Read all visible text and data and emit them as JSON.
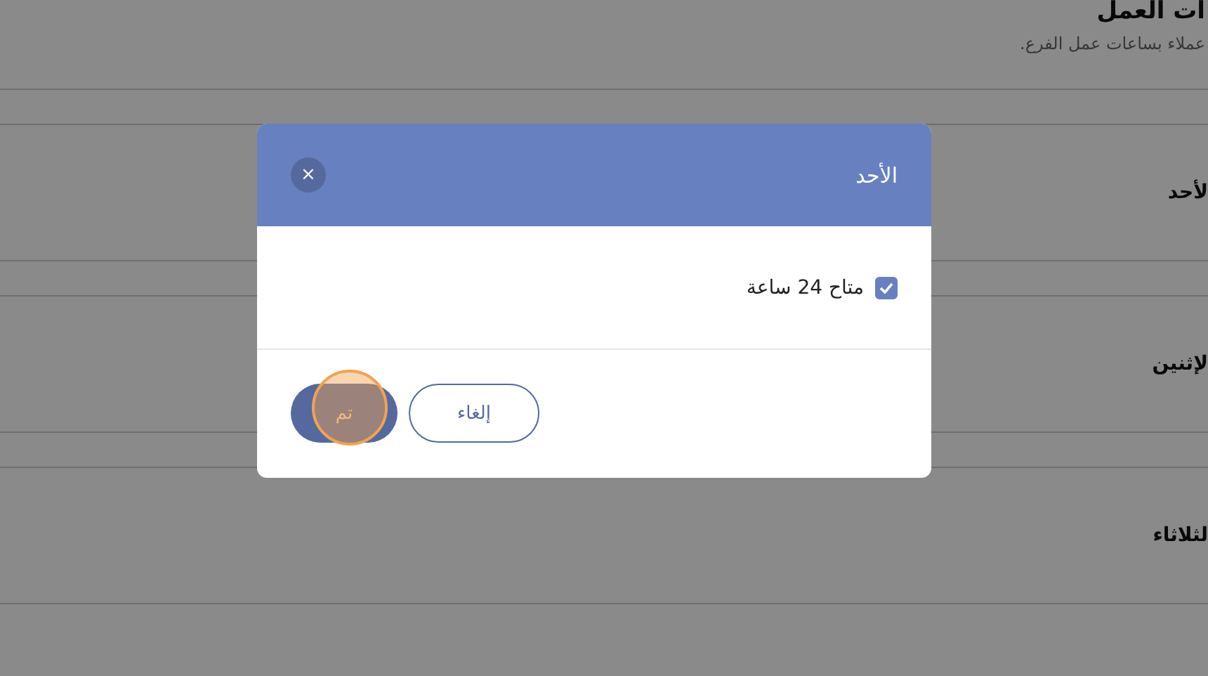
{
  "page": {
    "title": "ات العمل",
    "subtitle": "عملاء بساعات عمل الفرع.",
    "days": [
      {
        "label": "لأحد"
      },
      {
        "label": "لإثنين"
      },
      {
        "label": "لثلاثاء"
      }
    ]
  },
  "dialog": {
    "title": "الأحد",
    "close": "×",
    "option": {
      "label": "متاح 24 ساعة",
      "checked": true
    },
    "buttons": [
      {
        "kind": "outline",
        "label": "إلغاء"
      },
      {
        "kind": "primary",
        "label": "تم"
      }
    ]
  },
  "touch_indicator": {
    "kind": "tap"
  }
}
